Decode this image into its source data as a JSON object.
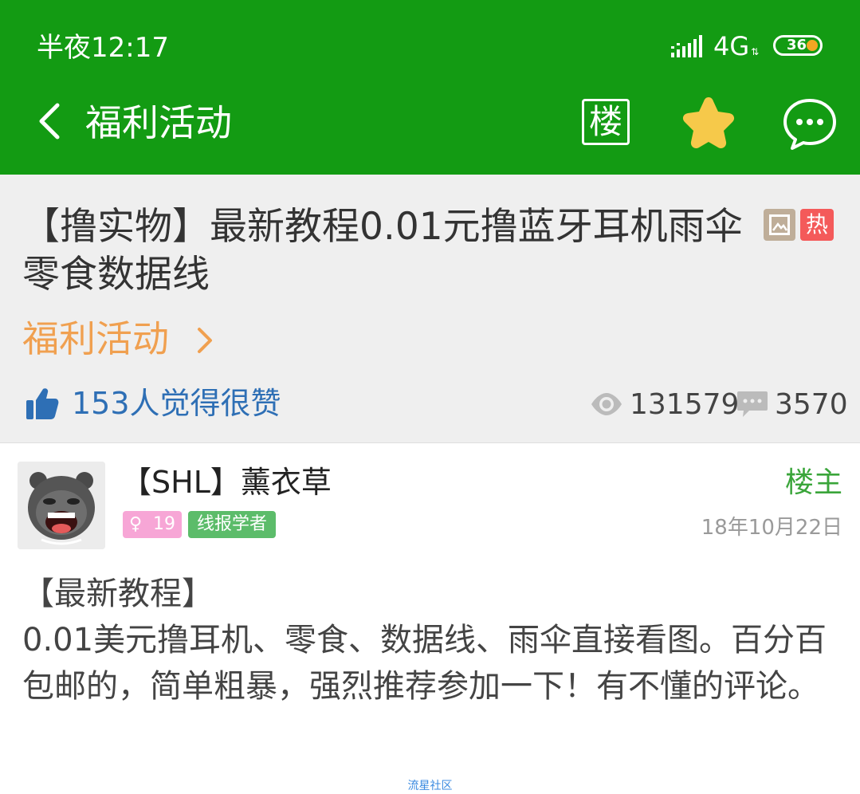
{
  "status_bar": {
    "time": "半夜12:17",
    "network": "4G",
    "network_arrows": "⇅",
    "battery": "36"
  },
  "nav": {
    "title": "福利活动",
    "floor_button": "楼",
    "icons": [
      "back-chevron-icon",
      "star-icon",
      "chat-bubble-icon"
    ]
  },
  "thread": {
    "title": "【撸实物】最新教程0.01元撸蓝牙耳机雨伞零食数据线",
    "hot_badge": "热",
    "category": "福利活动",
    "likes": "153人觉得很赞",
    "views": "131579",
    "comments": "3570"
  },
  "post": {
    "author": "【SHL】薰衣草",
    "level": "19",
    "rank": "线报学者",
    "op_label": "楼主",
    "date": "18年10月22日",
    "content_heading": "【最新教程】",
    "content_body": "0.01美元撸耳机、零食、数据线、雨伞直接看图。百分百包邮的，简单粗暴，强烈推荐参加一下！有不懂的评论。"
  },
  "watermark": "流星社区",
  "colors": {
    "brand_green": "#139b13",
    "category_orange": "#f0a050",
    "likes_blue": "#2e6fb5",
    "op_green": "#3aa53a",
    "hot_red": "#f45a5a"
  }
}
